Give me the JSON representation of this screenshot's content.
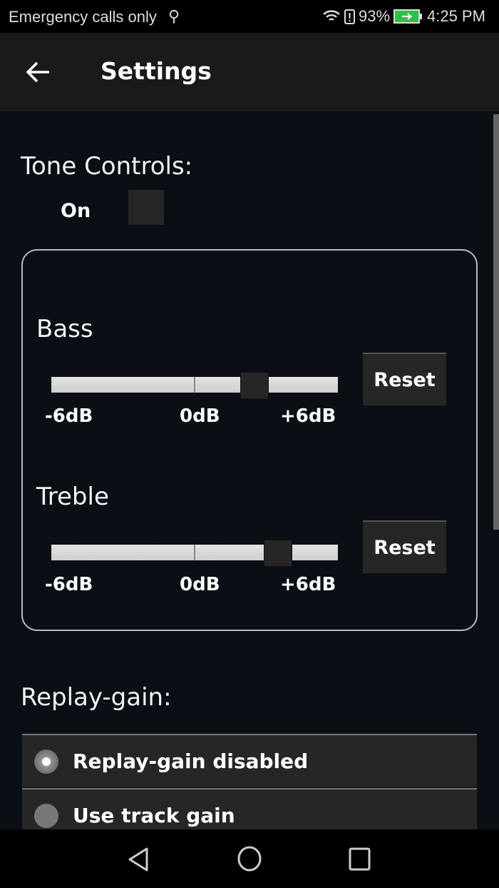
{
  "status_bar": {
    "carrier": "Emergency calls only",
    "battery": "93%",
    "time": "4:25 PM",
    "icons": [
      "usb-icon",
      "wifi-icon",
      "alert-icon",
      "battery-charging-icon"
    ]
  },
  "app_bar": {
    "title": "Settings",
    "back_icon": "arrow-left-icon"
  },
  "tone_controls": {
    "heading": "Tone Controls:",
    "on_label": "On",
    "on_checked": false,
    "bass": {
      "label": "Bass",
      "position_percent": 71,
      "min_label": "-6dB",
      "mid_label": "0dB",
      "max_label": "+6dB",
      "reset_label": "Reset"
    },
    "treble": {
      "label": "Treble",
      "position_percent": 79,
      "min_label": "-6dB",
      "mid_label": "0dB",
      "max_label": "+6dB",
      "reset_label": "Reset"
    }
  },
  "replay_gain": {
    "heading": "Replay-gain:",
    "options": [
      {
        "label": "Replay-gain disabled",
        "selected": true
      },
      {
        "label": "Use track gain",
        "selected": false
      }
    ]
  },
  "nav_bar": {
    "icons": [
      "back-triangle-icon",
      "home-circle-icon",
      "recents-square-icon"
    ]
  }
}
